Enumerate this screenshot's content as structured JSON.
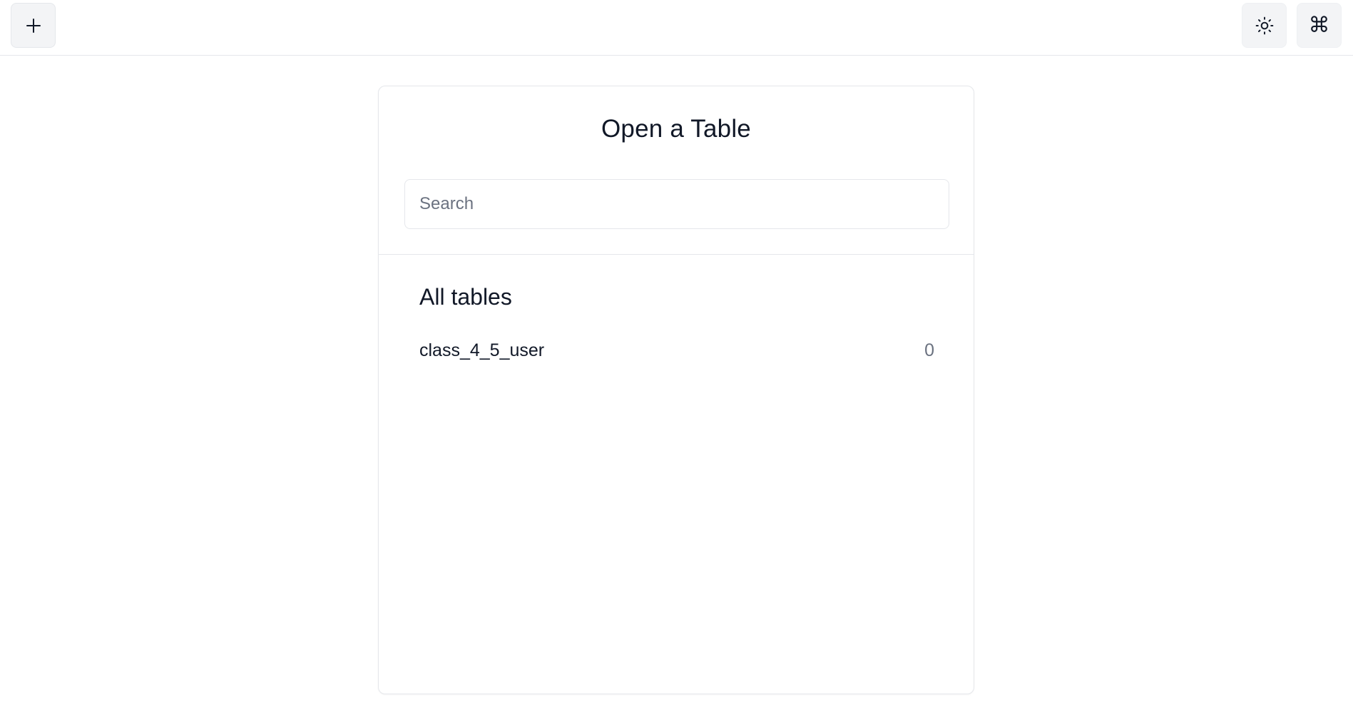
{
  "toolbar": {
    "add_icon": "plus-icon",
    "theme_icon": "sun-icon",
    "command_icon": "command-icon",
    "command_glyph": "⌘"
  },
  "dialog": {
    "title": "Open a Table",
    "search": {
      "placeholder": "Search",
      "value": ""
    },
    "section_title": "All tables",
    "tables": [
      {
        "name": "class_4_5_user",
        "count": "0"
      }
    ]
  },
  "colors": {
    "border": "#e5e7eb",
    "button_bg": "#f3f4f6",
    "text": "#111827",
    "muted": "#6b7280"
  }
}
